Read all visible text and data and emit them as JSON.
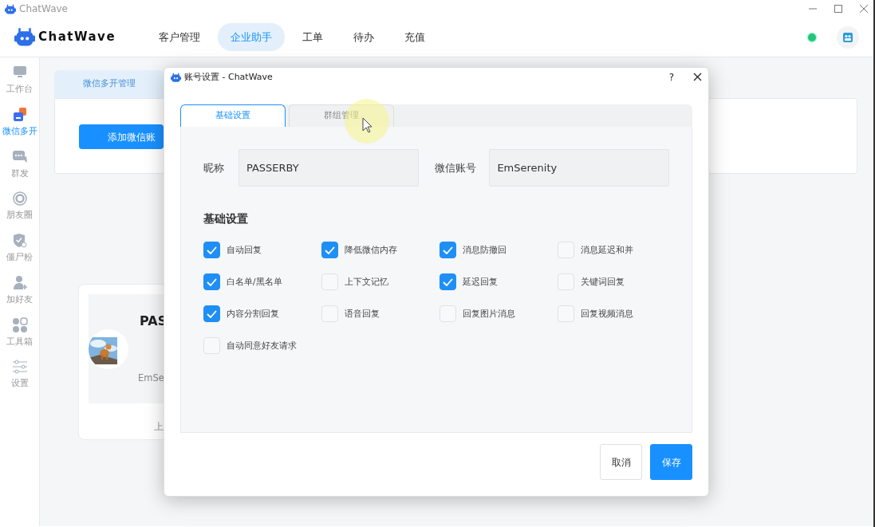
{
  "app": {
    "title": "ChatWave"
  },
  "header": {
    "logo": "ChatWave",
    "nav": [
      {
        "label": "客户管理",
        "selected": false
      },
      {
        "label": "企业助手",
        "selected": true
      },
      {
        "label": "工单",
        "selected": false
      },
      {
        "label": "待办",
        "selected": false
      },
      {
        "label": "充值",
        "selected": false
      }
    ]
  },
  "sidebar": {
    "items": [
      {
        "label": "工作台",
        "selected": false
      },
      {
        "label": "微信多开",
        "selected": true
      },
      {
        "label": "群发",
        "selected": false
      },
      {
        "label": "朋友圈",
        "selected": false
      },
      {
        "label": "僵尸粉",
        "selected": false
      },
      {
        "label": "加好友",
        "selected": false
      },
      {
        "label": "工具箱",
        "selected": false
      },
      {
        "label": "设置",
        "selected": false
      }
    ]
  },
  "background": {
    "tab": "微信多开管理",
    "add_button": "添加微信账",
    "account_card": {
      "name": "PAS",
      "wechat_id": "EmSe",
      "footer": "上"
    }
  },
  "dialog": {
    "title": "账号设置 - ChatWave",
    "help": "?",
    "tabs": [
      {
        "label": "基础设置",
        "selected": true
      },
      {
        "label": "群组管理",
        "selected": false
      }
    ],
    "fields": [
      {
        "label": "昵称",
        "value": "PASSERBY"
      },
      {
        "label": "微信账号",
        "value": "EmSerenity"
      }
    ],
    "section_title": "基础设置",
    "options": [
      {
        "label": "自动回复",
        "checked": true
      },
      {
        "label": "降低微信内存",
        "checked": true
      },
      {
        "label": "消息防撤回",
        "checked": true
      },
      {
        "label": "消息延迟和并",
        "checked": false
      },
      {
        "label": "白名单/黑名单",
        "checked": true
      },
      {
        "label": "上下文记忆",
        "checked": false
      },
      {
        "label": "延迟回复",
        "checked": true
      },
      {
        "label": "关键词回复",
        "checked": false
      },
      {
        "label": "内容分割回复",
        "checked": true
      },
      {
        "label": "语音回复",
        "checked": false
      },
      {
        "label": "回复图片消息",
        "checked": false
      },
      {
        "label": "回复视频消息",
        "checked": false
      },
      {
        "label": "自动同意好友请求",
        "checked": false
      }
    ],
    "buttons": [
      {
        "label": "取消",
        "kind": "secondary"
      },
      {
        "label": "保存",
        "kind": "primary"
      }
    ]
  }
}
